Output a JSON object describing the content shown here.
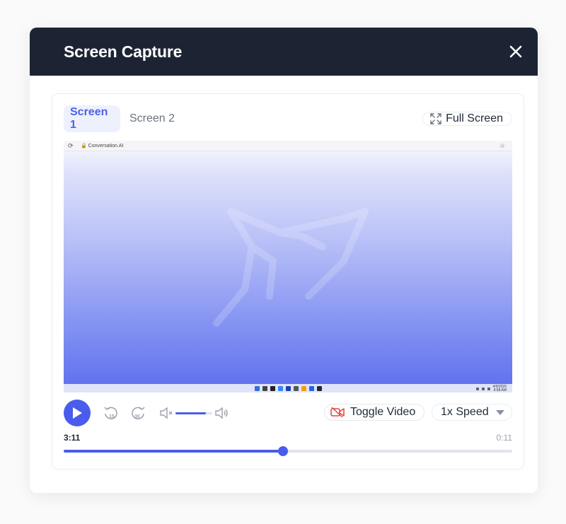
{
  "modal": {
    "title": "Screen Capture",
    "close_icon": "close-icon"
  },
  "tabs": [
    {
      "label": "Screen 1",
      "active": true
    },
    {
      "label": "Screen 2",
      "active": false
    }
  ],
  "fullscreen": {
    "label": "Full Screen",
    "icon": "expand-icon"
  },
  "preview": {
    "browser_url": "Conversation.AI",
    "taskbar_clock_line1": "4/9/2025",
    "taskbar_clock_line2": "9:58 AM"
  },
  "controls": {
    "play_icon": "play-icon",
    "rewind_icon": "rewind-15-icon",
    "forward_icon": "forward-30-icon",
    "mute_icon": "mute-icon",
    "volume_icon": "volume-high-icon",
    "volume_level": 0.82,
    "toggle_video_label": "Toggle Video",
    "toggle_video_icon": "video-off-icon",
    "speed_value": "1x Speed"
  },
  "timeline": {
    "current_time": "3:11",
    "end_time": "0:11",
    "progress": 0.489
  },
  "colors": {
    "header_bg": "#1c2434",
    "accent": "#4a5cec",
    "video_off_red": "#e0453a"
  }
}
